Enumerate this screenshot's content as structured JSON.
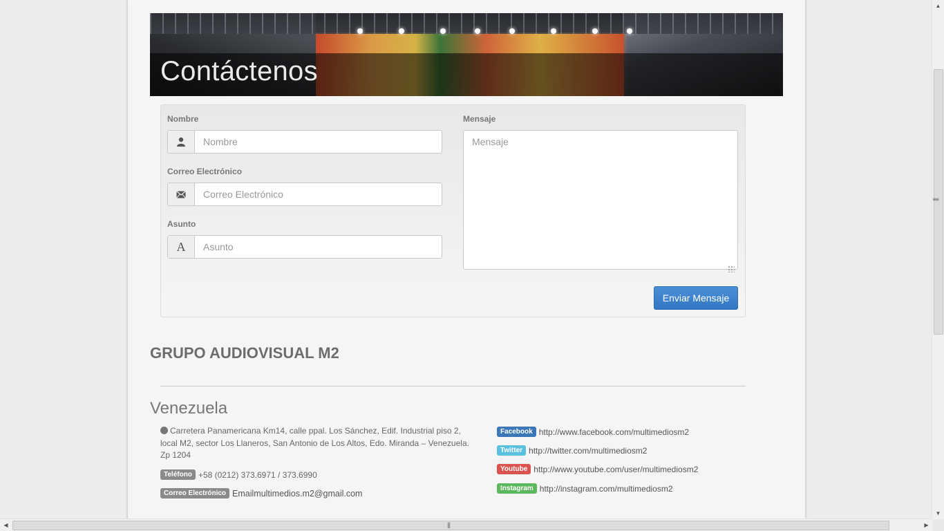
{
  "banner": {
    "title": "Contáctenos"
  },
  "form": {
    "name_label": "Nombre",
    "name_placeholder": "Nombre",
    "email_label": "Correo Electrónico",
    "email_placeholder": "Correo Electrónico",
    "subject_label": "Asunto",
    "subject_placeholder": "Asunto",
    "subject_icon_glyph": "A",
    "message_label": "Mensaje",
    "message_placeholder": "Mensaje",
    "submit_label": "Enviar Mensaje"
  },
  "company": {
    "name": "GRUPO AUDIOVISUAL M2",
    "country": "Venezuela",
    "address": "Carretera Panamericana Km14, calle ppal. Los Sánchez, Edif. Industrial piso 2, local M2, sector Los Llaneros, San Antonio de Los Altos, Edo. Miranda – Venezuela. Zp 1204",
    "phone_badge": "Teléfono",
    "phone": "+58 (0212) 373.6971 / 373.6990",
    "email_badge": "Correo Electrónico",
    "email": "Emailmultimedios.m2@gmail.com"
  },
  "social": [
    {
      "badge": "Facebook",
      "url": "http://www.facebook.com/multimediosm2",
      "color": "#3a77b8"
    },
    {
      "badge": "Twitter",
      "url": "http://twitter.com/multimediosm2",
      "color": "#5bc0de"
    },
    {
      "badge": "Youtube",
      "url": "http://www.youtube.com/user/multimediosm2",
      "color": "#d9534f"
    },
    {
      "badge": "Instagram",
      "url": "http://instagram.com/multimediosm2",
      "color": "#5cb85c"
    }
  ],
  "icons": {
    "name": "user-icon",
    "email": "envelope-icon",
    "subject": "font-icon",
    "address": "globe-icon"
  },
  "scrollbars": {
    "up_arrow": "▲",
    "down_arrow": "▼",
    "left_arrow": "◀",
    "right_arrow": "▶",
    "grip": "|||"
  }
}
